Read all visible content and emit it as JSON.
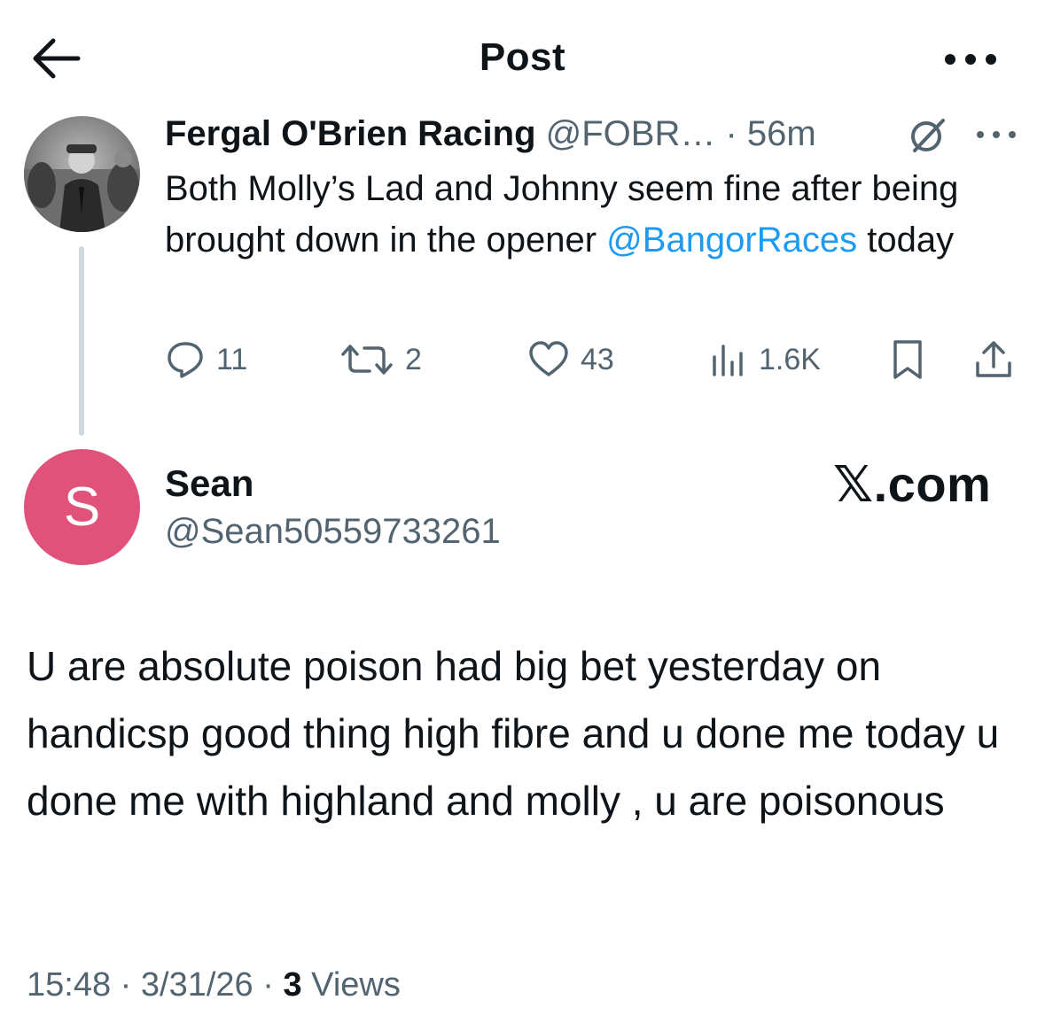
{
  "header": {
    "title": "Post",
    "back_icon": "arrow-left-icon",
    "more_icon": "more-horizontal-icon"
  },
  "parent_post": {
    "author_name": "Fergal O'Brien Racing",
    "handle": "@FOBR…",
    "separator": "·",
    "time": "56m",
    "text_before_mention": "Both Molly’s Lad and Johnny seem fine after being brought down in the opener ",
    "mention": "@BangorRaces",
    "text_after_mention": " today",
    "stats": {
      "replies": "11",
      "reposts": "2",
      "likes": "43",
      "views": "1.6K"
    },
    "icons": [
      "grok-icon",
      "more-horizontal-icon",
      "reply-icon",
      "repost-icon",
      "like-icon",
      "views-icon",
      "bookmark-icon",
      "share-icon"
    ]
  },
  "reply": {
    "avatar_letter": "S",
    "avatar_color": "#e0527a",
    "author_name": "Sean",
    "handle": "@Sean50559733261",
    "text": "U are absolute poison had big bet yesterday on handicsp good thing high fibre and u done me today u done me with highland and molly , u are poisonous",
    "time": "15:48",
    "separator": "·",
    "date": "3/31/26",
    "views_count": "3",
    "views_label": "Views"
  },
  "watermark": "𝕏.com",
  "colors": {
    "text": "#0f1419",
    "secondary": "#536471",
    "link": "#1d9bf0",
    "thread_line": "#cfd9de"
  }
}
